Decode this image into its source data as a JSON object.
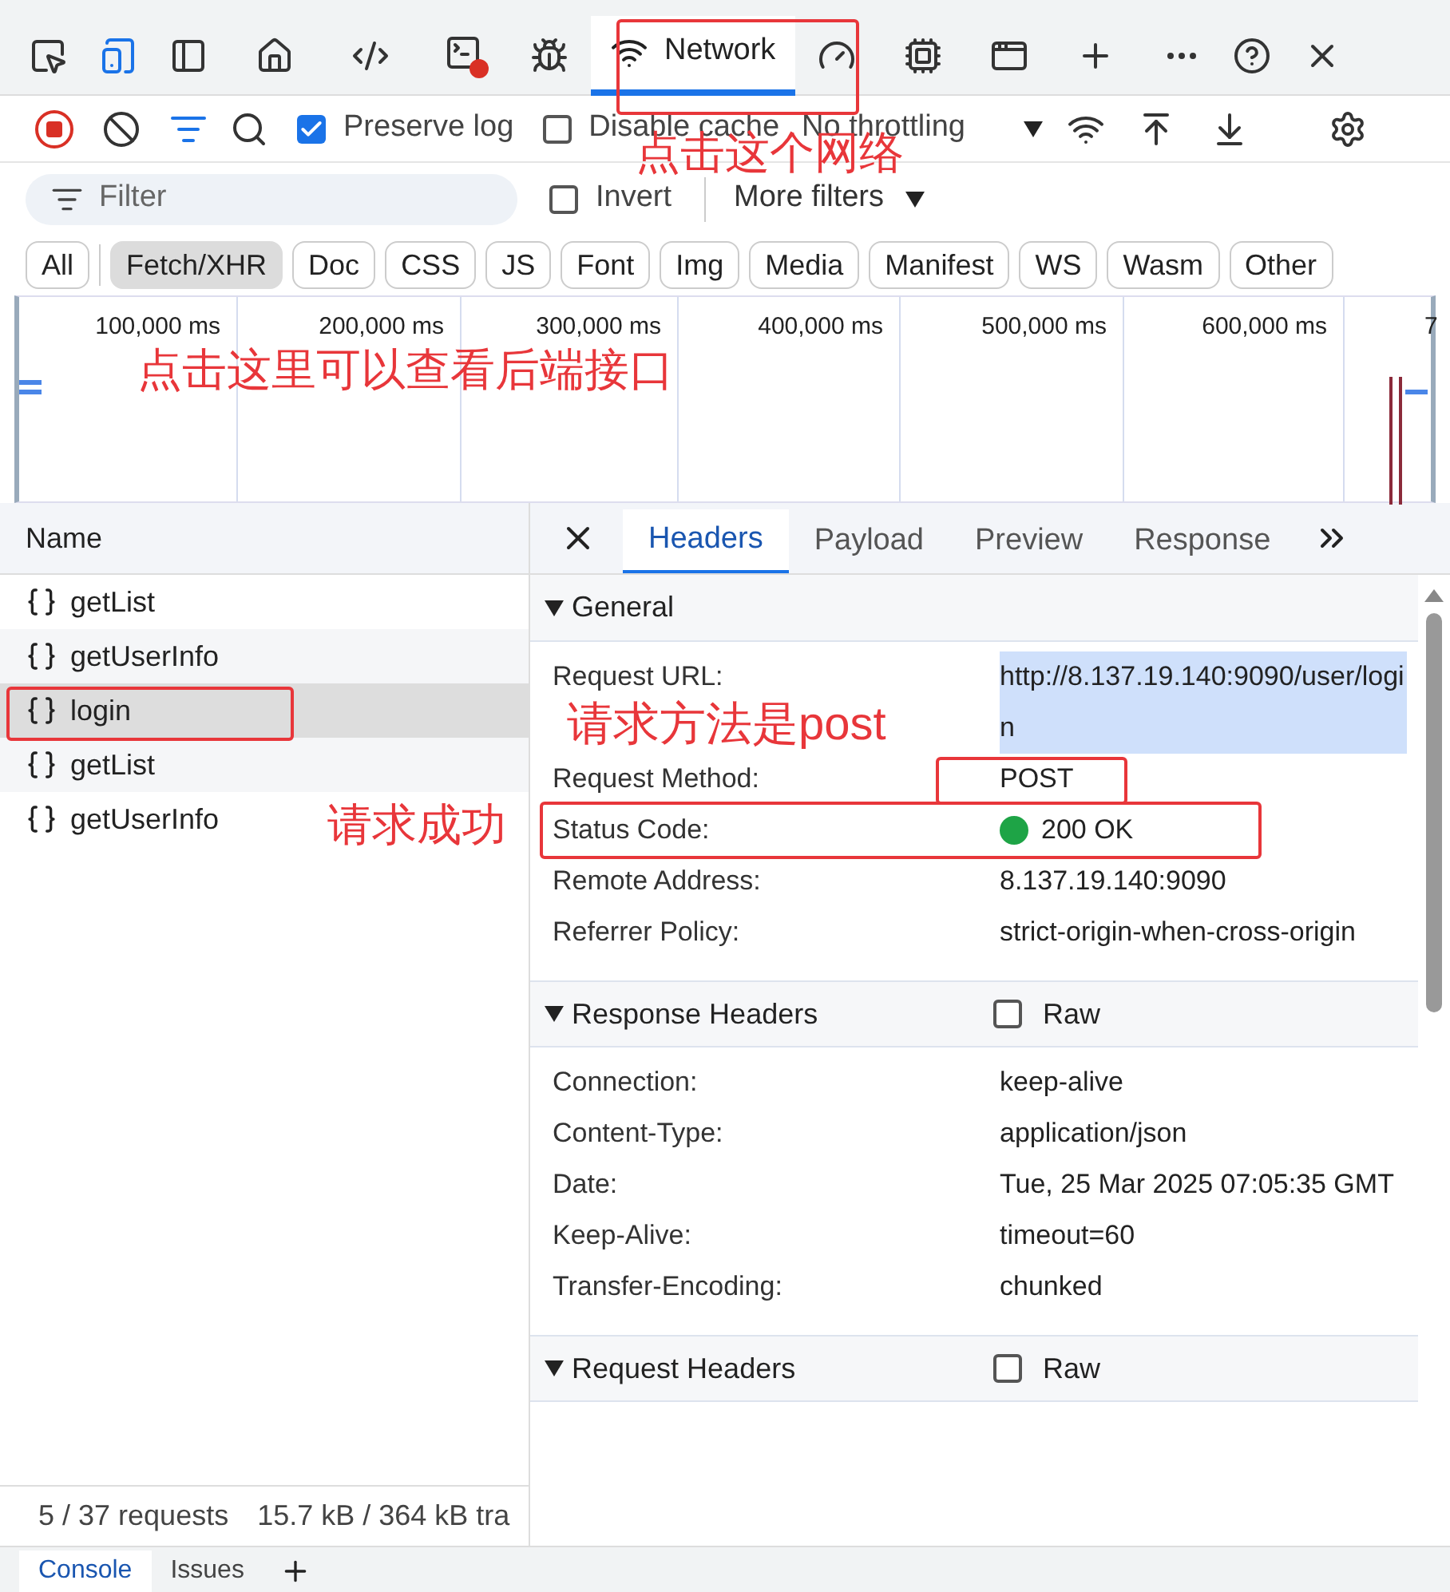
{
  "panel_tabs": [
    {
      "label": "Network",
      "selected": true
    }
  ],
  "toolbar": {
    "preserve_log": {
      "label": "Preserve log",
      "checked": true
    },
    "disable_cache": {
      "label": "Disable cache",
      "checked": false
    },
    "throttling": "No throttling"
  },
  "filter_bar": {
    "placeholder": "Filter",
    "invert": {
      "label": "Invert",
      "checked": false
    },
    "more_filters": "More filters"
  },
  "type_filters": [
    {
      "label": "All",
      "selected": false
    },
    {
      "label": "Fetch/XHR",
      "selected": true
    },
    {
      "label": "Doc",
      "selected": false
    },
    {
      "label": "CSS",
      "selected": false
    },
    {
      "label": "JS",
      "selected": false
    },
    {
      "label": "Font",
      "selected": false
    },
    {
      "label": "Img",
      "selected": false
    },
    {
      "label": "Media",
      "selected": false
    },
    {
      "label": "Manifest",
      "selected": false
    },
    {
      "label": "WS",
      "selected": false
    },
    {
      "label": "Wasm",
      "selected": false
    },
    {
      "label": "Other",
      "selected": false
    }
  ],
  "timeline": {
    "ticks": [
      "100,000 ms",
      "200,000 ms",
      "300,000 ms",
      "400,000 ms",
      "500,000 ms",
      "600,000 ms",
      "7"
    ]
  },
  "requests": {
    "column": "Name",
    "rows": [
      {
        "name": "getList",
        "selected": false
      },
      {
        "name": "getUserInfo",
        "selected": false
      },
      {
        "name": "login",
        "selected": true
      },
      {
        "name": "getList",
        "selected": false
      },
      {
        "name": "getUserInfo",
        "selected": false
      }
    ]
  },
  "detail_tabs": [
    {
      "label": "Headers",
      "selected": true
    },
    {
      "label": "Payload",
      "selected": false
    },
    {
      "label": "Preview",
      "selected": false
    },
    {
      "label": "Response",
      "selected": false
    }
  ],
  "sections": [
    {
      "title": "General",
      "expanded": true,
      "rows": [
        {
          "kind": "url",
          "label": "Request URL:",
          "value": "http://8.137.19.140:9090/user/login"
        },
        {
          "kind": "text",
          "label": "Request Method:",
          "value": "POST"
        },
        {
          "kind": "status",
          "label": "Status Code:",
          "value": "200 OK",
          "color": "#1ea446"
        },
        {
          "kind": "text",
          "label": "Remote Address:",
          "value": "8.137.19.140:9090"
        },
        {
          "kind": "text",
          "label": "Referrer Policy:",
          "value": "strict-origin-when-cross-origin"
        }
      ]
    },
    {
      "title": "Response Headers",
      "expanded": true,
      "raw": {
        "label": "Raw",
        "checked": false
      },
      "rows": [
        {
          "kind": "text",
          "label": "Connection:",
          "value": "keep-alive"
        },
        {
          "kind": "text",
          "label": "Content-Type:",
          "value": "application/json"
        },
        {
          "kind": "text",
          "label": "Date:",
          "value": "Tue, 25 Mar 2025 07:05:35 GMT"
        },
        {
          "kind": "text",
          "label": "Keep-Alive:",
          "value": "timeout=60"
        },
        {
          "kind": "text",
          "label": "Transfer-Encoding:",
          "value": "chunked"
        }
      ]
    },
    {
      "title": "Request Headers",
      "expanded": true,
      "raw": {
        "label": "Raw",
        "checked": false
      }
    }
  ],
  "status_bar": [
    "5 / 37 requests",
    "15.7 kB / 364 kB tra"
  ],
  "drawer_tabs": [
    {
      "label": "Console",
      "selected": true
    },
    {
      "label": "Issues",
      "selected": false
    }
  ],
  "annotations": [
    "点击这个网络",
    "点击这里可以查看后端接口",
    "请求方法是post",
    "请求成功"
  ]
}
